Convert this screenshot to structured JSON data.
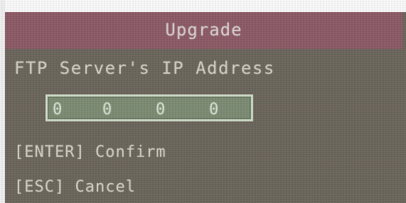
{
  "dialog": {
    "title": "Upgrade",
    "ip_label": "FTP Server's IP Address",
    "ip_octets": [
      "0",
      "0",
      "0",
      "0"
    ],
    "enter_hint": "[ENTER] Confirm",
    "esc_hint": "[ESC] Cancel"
  },
  "colors": {
    "title_bar": "#8d5a66",
    "background": "#6c665c",
    "ip_box_fill": "#7d8c74",
    "ip_box_border": "#cfdcc9",
    "text": "#d4d1c7"
  }
}
